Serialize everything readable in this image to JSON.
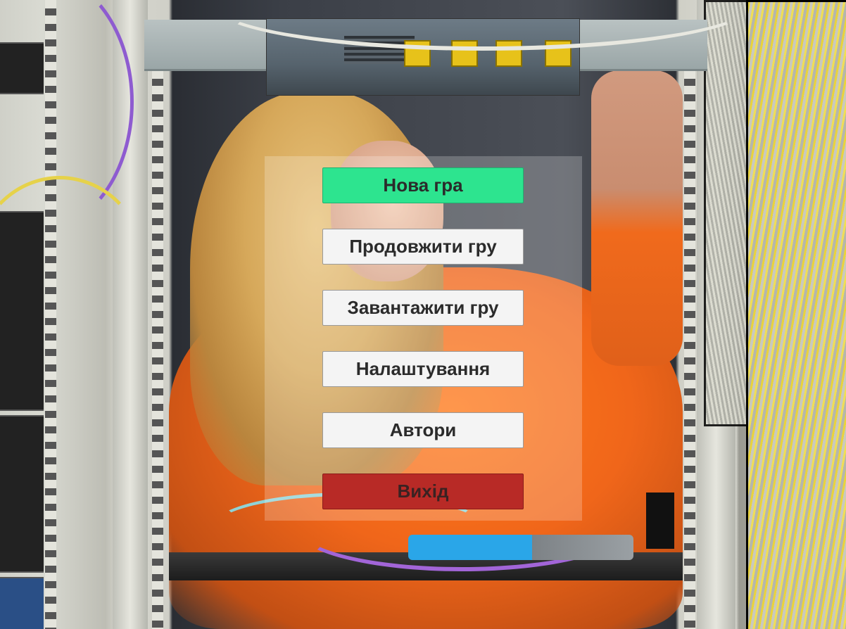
{
  "main_menu": {
    "buttons": [
      {
        "id": "new_game",
        "label": "Нова гра",
        "color": "#2de48f"
      },
      {
        "id": "continue_game",
        "label": "Продовжити гру",
        "color": "#f4f4f4"
      },
      {
        "id": "load_game",
        "label": "Завантажити гру",
        "color": "#f4f4f4"
      },
      {
        "id": "settings",
        "label": "Налаштування",
        "color": "#f4f4f4"
      },
      {
        "id": "authors",
        "label": "Автори",
        "color": "#f4f4f4"
      },
      {
        "id": "exit",
        "label": "Вихід",
        "color": "#b82a26"
      }
    ]
  },
  "background": {
    "scene": "server-rack-technician-photo"
  }
}
